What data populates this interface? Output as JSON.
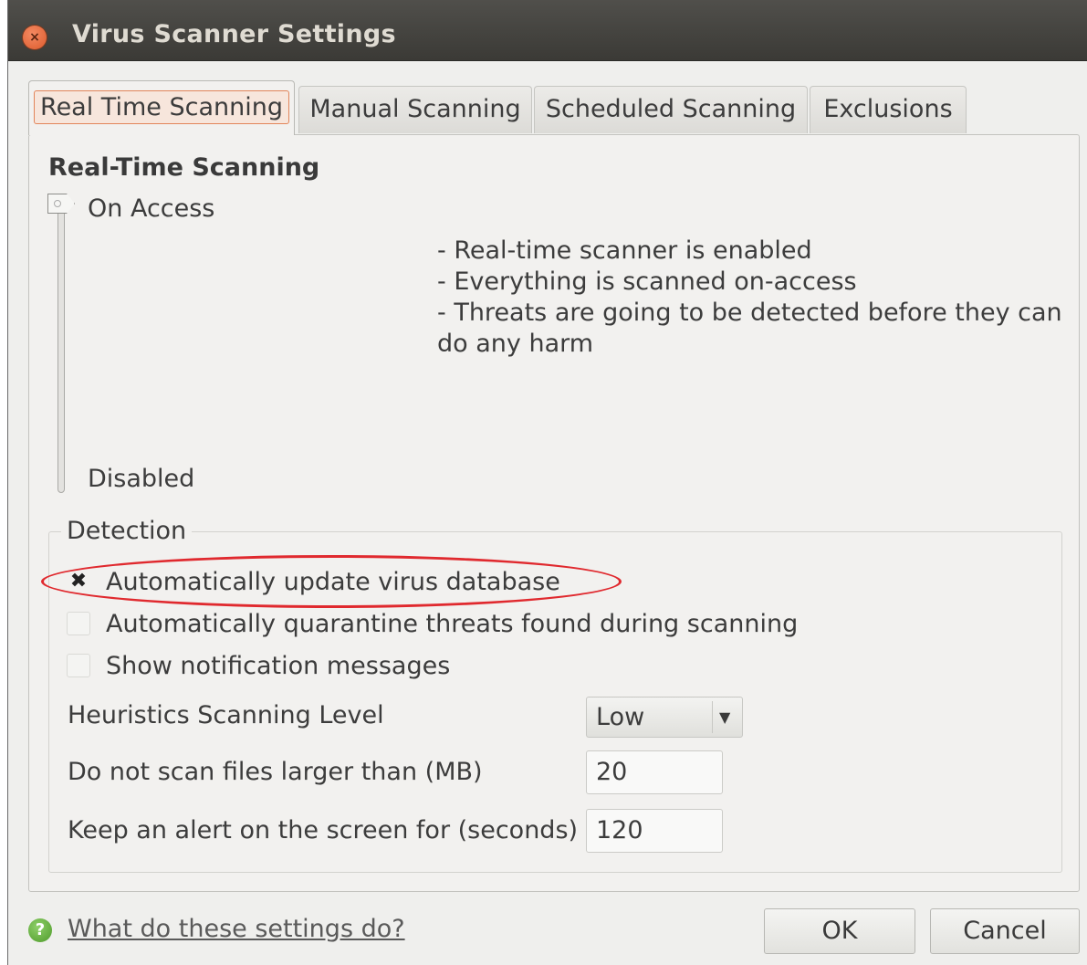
{
  "window": {
    "title": "Virus Scanner Settings",
    "close_icon": "×"
  },
  "tabs": [
    {
      "label": "Real Time Scanning",
      "active": true
    },
    {
      "label": "Manual Scanning",
      "active": false
    },
    {
      "label": "Scheduled Scanning",
      "active": false
    },
    {
      "label": "Exclusions",
      "active": false
    }
  ],
  "realtime": {
    "heading": "Real-Time Scanning",
    "slider": {
      "top_label": "On Access",
      "bottom_label": "Disabled",
      "selected": "On Access"
    },
    "description": [
      "- Real-time scanner is enabled",
      "- Everything is scanned on-access",
      "- Threats are going to be detected before they can",
      "do any harm"
    ]
  },
  "detection": {
    "legend": "Detection",
    "checkboxes": [
      {
        "label": "Automatically update virus database",
        "checked": true,
        "mark": "✖"
      },
      {
        "label": "Automatically quarantine threats found during scanning",
        "checked": false,
        "mark": ""
      },
      {
        "label": "Show notification messages",
        "checked": false,
        "mark": ""
      }
    ],
    "heuristics": {
      "label": "Heuristics Scanning Level",
      "value": "Low",
      "arrow": "▼"
    },
    "max_file_size": {
      "label": "Do not scan files larger than (MB)",
      "value": "20"
    },
    "alert_duration": {
      "label": "Keep an alert on the screen for (seconds)",
      "value": "120"
    }
  },
  "footer": {
    "help_icon": "?",
    "help_link": "What do these settings do?",
    "ok_label": "OK",
    "cancel_label": "Cancel"
  },
  "colors": {
    "highlight_ellipse": "#e0292e",
    "active_tab_outline": "#e2855a"
  }
}
